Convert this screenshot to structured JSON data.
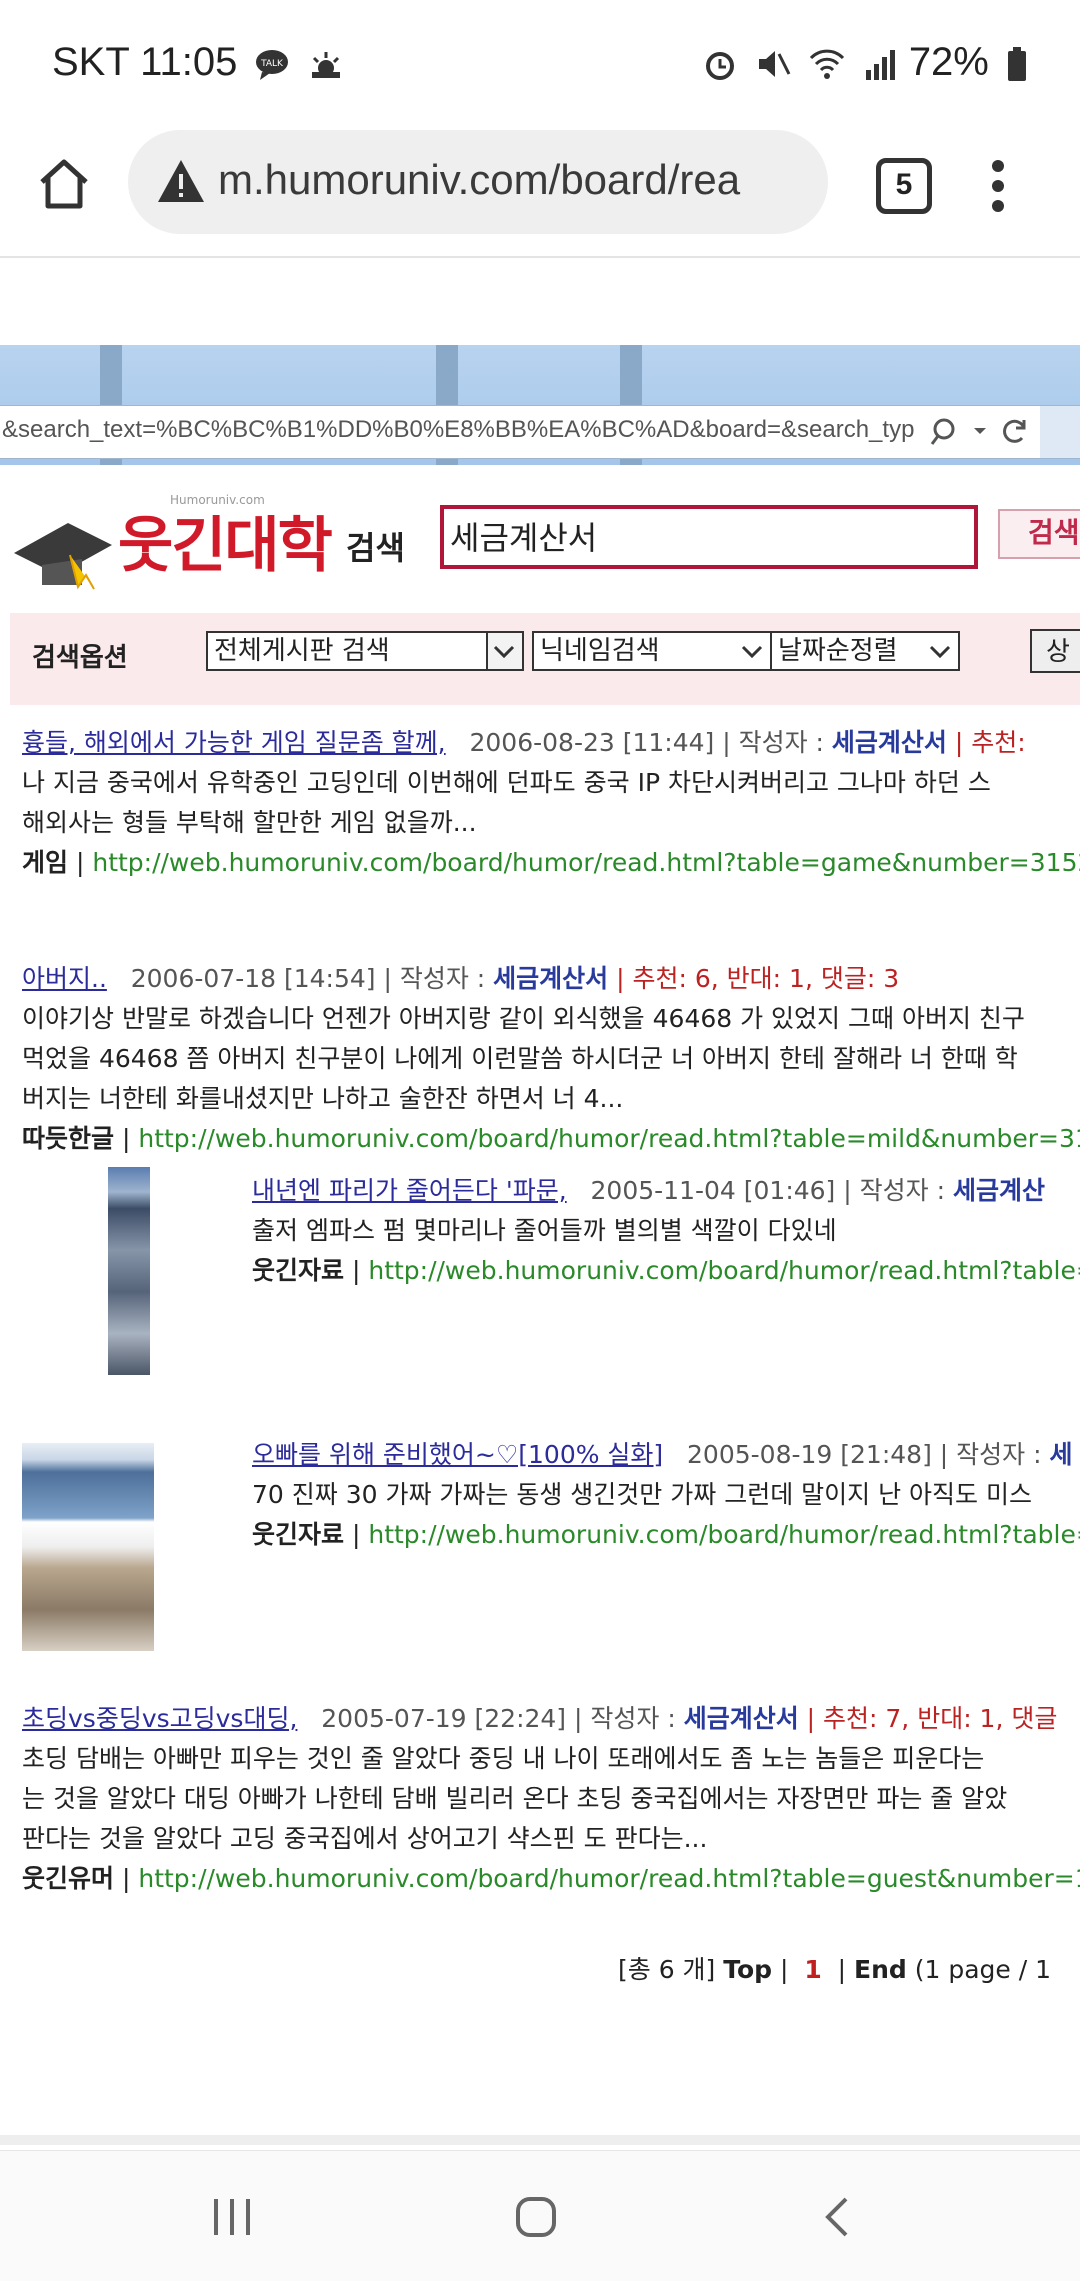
{
  "status": {
    "carrier_time": "SKT 11:05",
    "battery": "72%",
    "icons": [
      "talk-icon",
      "weather-icon",
      "alarm-icon",
      "mute-icon",
      "wifi-icon",
      "signal-icon",
      "battery-icon"
    ]
  },
  "browser": {
    "url": "m.humoruniv.com/board/rea",
    "tab_count": "5"
  },
  "ie": {
    "address": "&search_text=%BC%BC%B1%DD%B0%E8%BB%EA%BC%AD&board=&search_typ"
  },
  "site": {
    "logo": "웃긴대학",
    "logo_sub": "Humoruniv.com",
    "search_label": "검색",
    "search_value": "세금계산서",
    "search_button": "검색",
    "options_label": "검색옵션",
    "opt1": "전체게시판 검색",
    "opt2": "닉네임검색",
    "opt3": "날짜순정렬",
    "opt_button": "상"
  },
  "results": [
    {
      "title": "흉들, 해외에서 가능한 게임 질문좀 할께,",
      "meta": "2006-08-23 [11:44] | 작성자 : ",
      "author": "세금계산서",
      "rec": " | 추천: ",
      "body1": "나 지금 중국에서 유학중인 고딩인데 이번해에 던파도 중국 IP 차단시켜버리고 그나마 하던 스",
      "body2": "해외사는 형들 부탁해 할만한 게임 없을까...",
      "category": "게임",
      "link": "http://web.humoruniv.com/board/humor/read.html?table=game&number=315262"
    },
    {
      "title": "아버지..",
      "meta": "2006-07-18 [14:54] | 작성자 : ",
      "author": "세금계산서",
      "rec": " | 추천: 6, 반대: 1, 댓글: 3",
      "body1": "이야기상 반말로 하겠습니다 언젠가 아버지랑 같이 외식했을 46468 가 있었지 그때 아버지 친구",
      "body2": "먹었을 46468 쯤 아버지 친구분이 나에게 이런말씀 하시더군 너 아버지 한테 잘해라 너 한때 학",
      "body3": "버지는 너한테 화를내셨지만 나하고 술한잔 하면서 너 4...",
      "category": "따듯한글",
      "link": "http://web.humoruniv.com/board/humor/read.html?table=mild&number=31187"
    },
    {
      "title": "내년엔 파리가 줄어든다 '파문,",
      "meta": "2005-11-04 [01:46] | 작성자 : ",
      "author": "세금계산",
      "body1": "출저 엠파스 펌 몇마리나 줄어들까 별의별 색깔이 다있네",
      "category": "웃긴자료",
      "link": "http://web.humoruniv.com/board/humor/read.html?table="
    },
    {
      "title": "오빠를 위해 준비했어~♡[100% 실화]",
      "meta": "2005-08-19 [21:48] | 작성자 : ",
      "author": "세",
      "body1": "70 진짜 30 가짜 가짜는 동생 생긴것만 가짜 그런데 말이지 난 아직도 미스",
      "category": "웃긴자료",
      "link": "http://web.humoruniv.com/board/humor/read.html?table="
    },
    {
      "title": "초딩vs중딩vs고딩vs대딩,",
      "meta": "2005-07-19 [22:24] | 작성자 : ",
      "author": "세금계산서",
      "rec": " | 추천: 7, 반대: 1, 댓글",
      "body1": "초딩 담배는 아빠만 피우는 것인 줄 알았다 중딩 내 나이 또래에서도 좀 노는 놈들은 피운다는",
      "body2": "는 것을 알았다 대딩 아빠가 나한테 담배 빌리러 온다 초딩 중국집에서는 자장면만 파는 줄 알았",
      "body3": "판다는 것을 알았다 고딩 중국집에서 상어고기 샥스핀 도 판다는...",
      "category": "웃긴유머",
      "link": "http://web.humoruniv.com/board/humor/read.html?table=guest&number=1585"
    }
  ],
  "pager": {
    "total": "[총 6 개]",
    "top": "Top",
    "current": "1",
    "end": "End",
    "info": "(1 page / 1"
  }
}
